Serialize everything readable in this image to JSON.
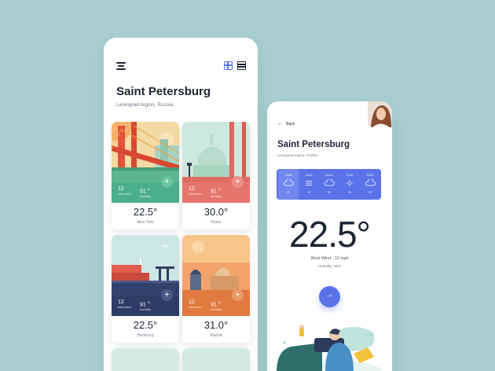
{
  "list_screen": {
    "title": "Saint Petersburg",
    "subtitle": "Leningrad region, Russia",
    "cards": [
      {
        "city": "New York",
        "temp": "22.5°",
        "wind_value": "12",
        "wind_label": "west wind",
        "humidity_value": "91",
        "humidity_unit": "%",
        "humidity_label": "humidity",
        "plus": "+",
        "accent": "#4caf8c"
      },
      {
        "city": "Rome",
        "temp": "30.0°",
        "wind_value": "12",
        "wind_label": "west wind",
        "humidity_value": "91",
        "humidity_unit": "%",
        "humidity_label": "humidity",
        "plus": "+",
        "accent": "#e5756c"
      },
      {
        "city": "Humburg",
        "temp": "22.5°",
        "wind_value": "12",
        "wind_label": "west wind",
        "humidity_value": "91",
        "humidity_unit": "%",
        "humidity_label": "humidity",
        "plus": "+",
        "accent": "#3b4a6b"
      },
      {
        "city": "Madrid",
        "temp": "31.0°",
        "wind_value": "12",
        "wind_label": "west wind",
        "humidity_value": "91",
        "humidity_unit": "%",
        "humidity_label": "humidity",
        "plus": "+",
        "accent": "#e07a3f"
      }
    ],
    "icons": {
      "menu": "menu-icon",
      "grid_view": "grid-view-icon",
      "list_view": "list-view-icon"
    }
  },
  "detail_screen": {
    "back_arrow": "←",
    "back_label": "Back",
    "title": "Saint Petersburg",
    "subtitle": "Leningrad region, Russia",
    "hourly": [
      {
        "time": "13:00",
        "icon": "cloud-icon",
        "temp": "21"
      },
      {
        "time": "14:00",
        "icon": "wind-icon",
        "temp": "24"
      },
      {
        "time": "15:00",
        "icon": "cloud-icon",
        "temp": "22"
      },
      {
        "time": "17:00",
        "icon": "sun-icon",
        "temp": "25"
      },
      {
        "time": "20:00",
        "icon": "cloud-icon",
        "temp": "23"
      }
    ],
    "temperature": "22.5°",
    "wind": "West Wind - 12 mph",
    "humidity": "Humidity: 91%",
    "go_arrow": "→",
    "accent": "#5b73e8"
  }
}
